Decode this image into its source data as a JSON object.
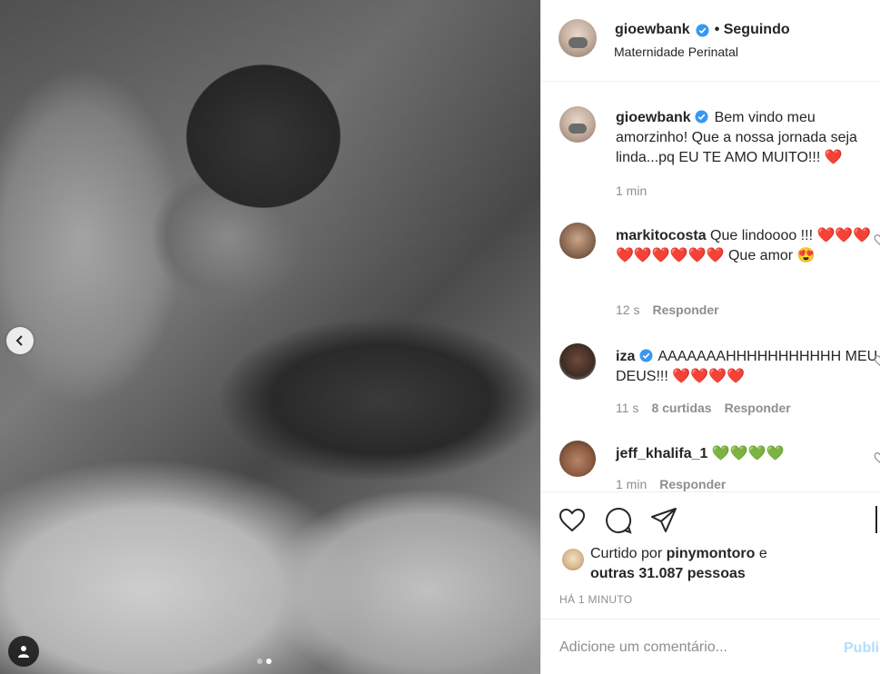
{
  "post": {
    "photo_alt": "black and white photo",
    "carousel": {
      "total": 2,
      "active": 2
    }
  },
  "header": {
    "username": "gioewbank",
    "follow_status": "• Seguindo",
    "location": "Maternidade Perinatal"
  },
  "caption": {
    "username": "gioewbank",
    "text": "Bem vindo meu amorzinho! Que a nossa jornada seja linda...pq EU TE AMO MUITO!!!",
    "emoji": "❤️",
    "time": "1 min"
  },
  "comments": [
    {
      "username": "markitocosta",
      "text": "Que lindoooo !!!",
      "hearts": "❤️❤️❤️❤️❤️❤️❤️❤️❤️",
      "tail": "Que amor",
      "tail_emoji": "😍",
      "time": "12 s",
      "likes": "",
      "reply": "Responder"
    },
    {
      "username": "iza",
      "verified": true,
      "text": "AAAAAAAHHHHHHHHHHH MEU DEUS!!!",
      "hearts": "❤️❤️❤️❤️",
      "time": "11 s",
      "likes": "8 curtidas",
      "reply": "Responder"
    },
    {
      "username": "jeff_khalifa_1",
      "hearts": "💚💚💚💚",
      "time": "1 min",
      "reply": "Responder"
    }
  ],
  "actions": {
    "liked_by_prefix": "Curtido por",
    "liked_by_user": "pinymontoro",
    "liked_by_joiner": "e",
    "liked_by_others": "outras 31.087 pessoas",
    "time_ago": "HÁ 1 MINUTO"
  },
  "add_comment": {
    "placeholder": "Adicione um comentário...",
    "publish": "Publicar"
  },
  "colors": {
    "verified": "#3897f0",
    "heart_red": "#e0213c",
    "heart_green": "#2ab23a",
    "publish_disabled": "#b2dffc",
    "muted": "#8e8e8e"
  }
}
